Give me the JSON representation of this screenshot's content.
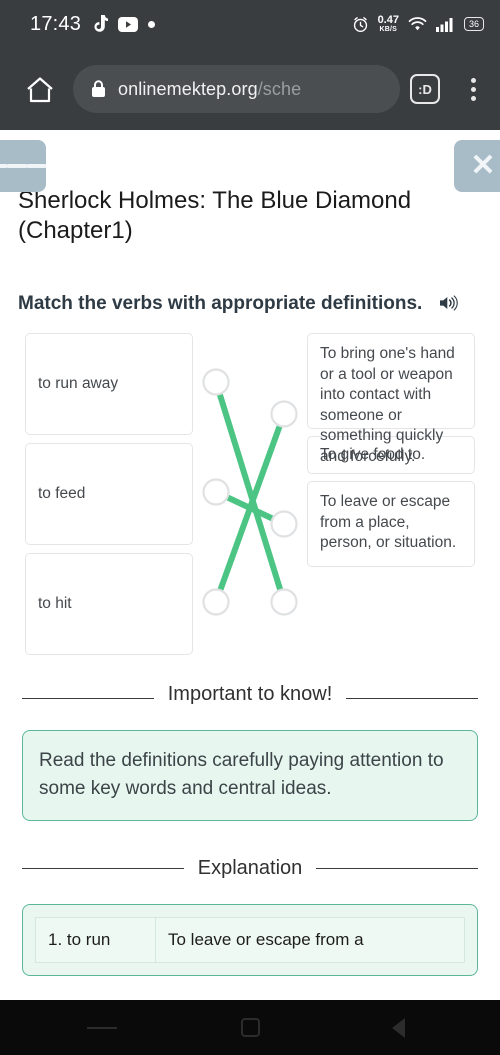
{
  "status_bar": {
    "clock": "17:43",
    "tiktok_icon": "tiktok-icon",
    "youtube_icon": "youtube-icon",
    "dot_icon": "dot-icon",
    "alarm_icon": "alarm-clock-icon",
    "net_speed_value": "0.47",
    "net_speed_unit": "KB/S",
    "wifi_icon": "wifi-icon",
    "signal_icon": "cellular-signal-icon",
    "battery_level": "36"
  },
  "browser": {
    "home_icon": "home-icon",
    "lock_icon": "lock-padlock-icon",
    "url_visible": "onlinemektep.org",
    "url_tail": "/sche",
    "url_full": "onlinemektep.org/sche",
    "tab_count_label": ":D",
    "menu_icon": "three-dots-menu-icon"
  },
  "lesson": {
    "menu_button_icon": "hamburger-menu-icon",
    "close_button_icon": "close-x-icon",
    "title": "Sherlock Holmes: The Blue Diamond (Chapter1)",
    "prompt": "Match the verbs with appropriate definitions.",
    "speaker_icon": "speaker-sound-icon"
  },
  "match_exercise": {
    "left_items": [
      {
        "id": "L1",
        "label": "to run away"
      },
      {
        "id": "L2",
        "label": "to feed"
      },
      {
        "id": "L3",
        "label": "to hit"
      }
    ],
    "right_items": [
      {
        "id": "R1",
        "label": "To bring one's hand or a tool or weapon into contact with someone or something quickly and forcefully."
      },
      {
        "id": "R2",
        "label": "To give food to."
      },
      {
        "id": "R3",
        "label": "To leave or escape from a place, person, or situation."
      }
    ],
    "connections": [
      {
        "from": "L1",
        "to": "R3"
      },
      {
        "from": "L2",
        "to": "R2"
      },
      {
        "from": "L3",
        "to": "R1"
      }
    ],
    "line_color": "#4cc483",
    "node_color": "#dfe1e3"
  },
  "important": {
    "heading": "Important to know!",
    "body": "Read the definitions carefully paying attention to some key words and central ideas.",
    "accent_color": "#5cb79a",
    "background_color": "#e7f6ef"
  },
  "explanation": {
    "heading": "Explanation",
    "rows": [
      {
        "term": "1. to run",
        "definition": "To leave or escape from a"
      }
    ]
  },
  "nav_bar": {
    "recents_icon": "recents-icon",
    "home_icon": "home-square-icon",
    "back_icon": "back-triangle-icon"
  }
}
